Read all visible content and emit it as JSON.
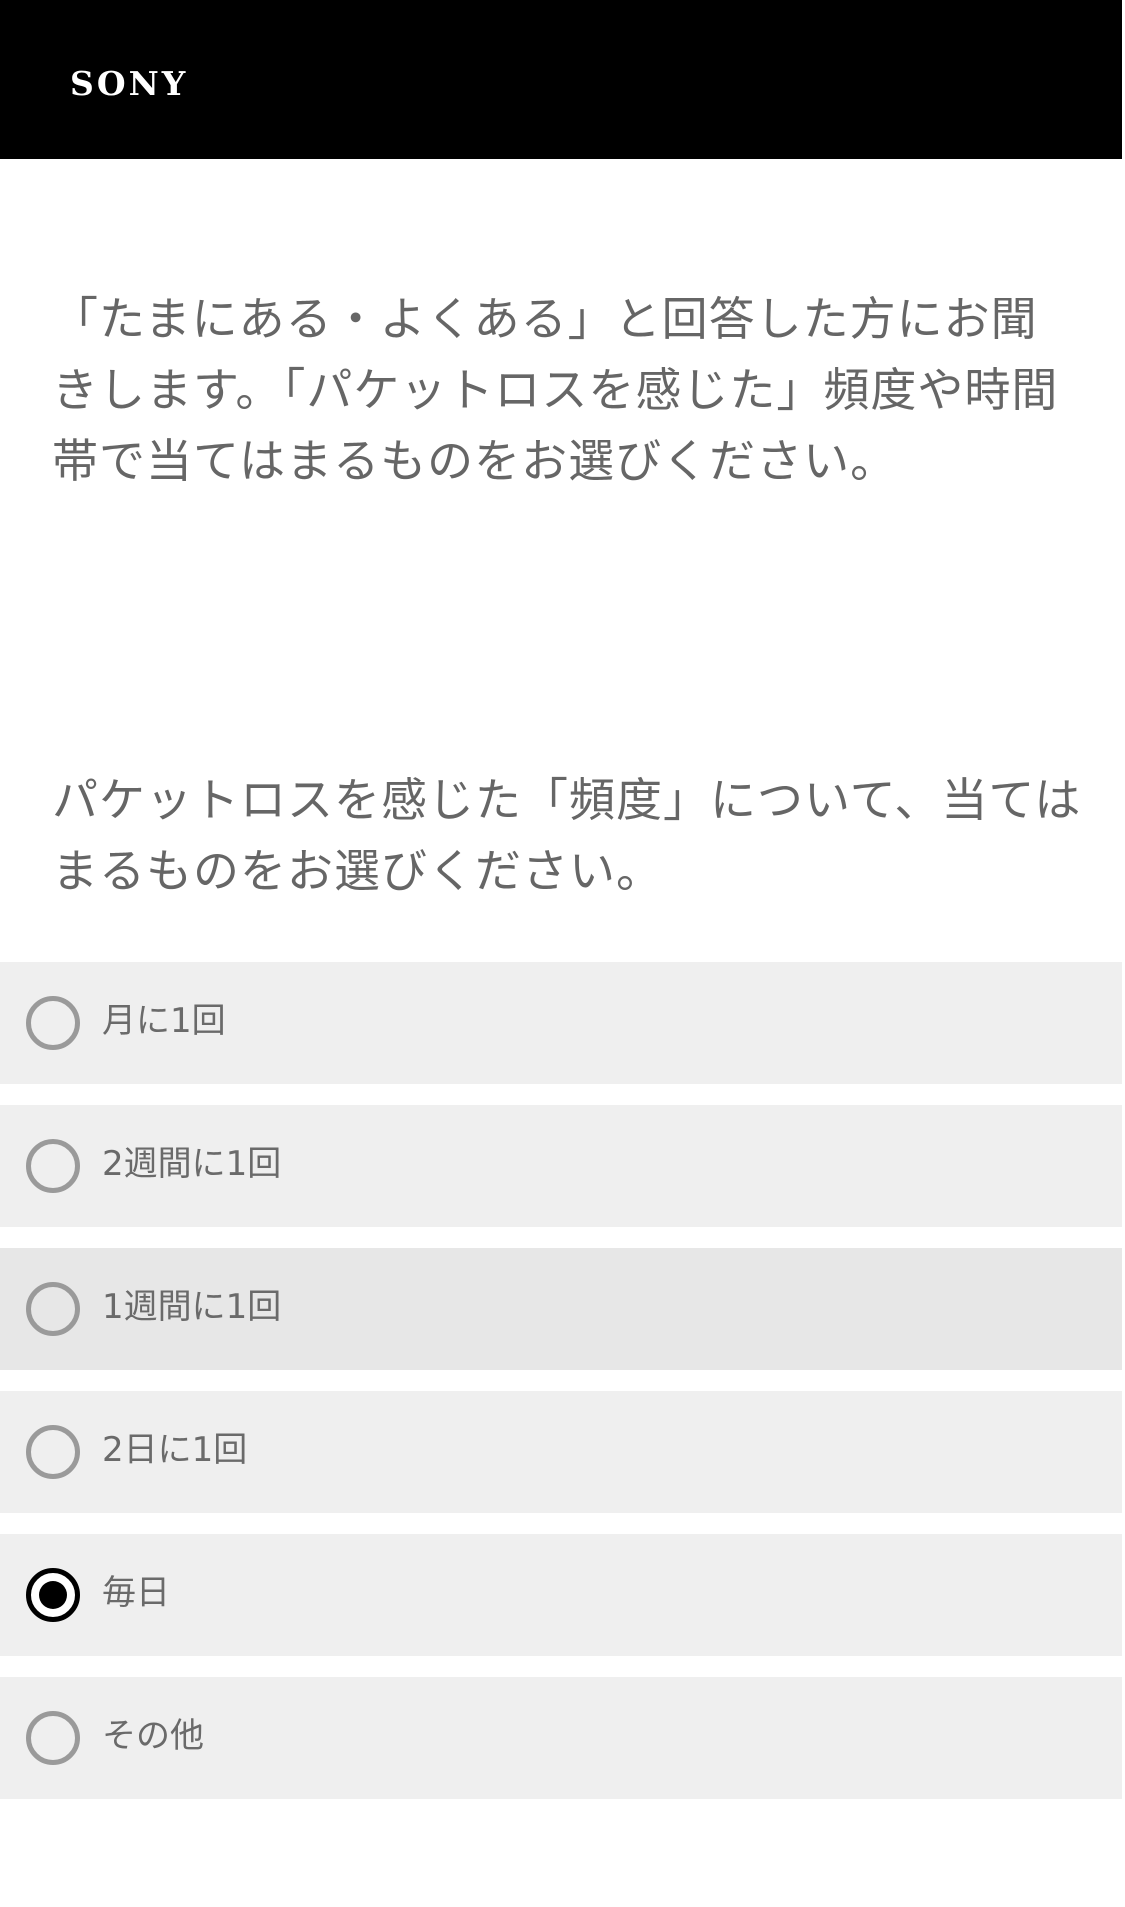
{
  "header": {
    "logo_text": "SONY"
  },
  "intro": {
    "text": "「たまにある・よくある」と回答した方にお聞きします。「パケットロスを感じた」頻度や時間帯で当てはまるものをお選びください。"
  },
  "question": {
    "text": "パケットロスを感じた「頻度」について、当てはまるものをお選びください。",
    "options": [
      {
        "label": "月に1回",
        "selected": false
      },
      {
        "label": "2週間に1回",
        "selected": false
      },
      {
        "label": "1週間に1回",
        "selected": false
      },
      {
        "label": "2日に1回",
        "selected": false
      },
      {
        "label": "毎日",
        "selected": true
      },
      {
        "label": "その他",
        "selected": false
      }
    ]
  },
  "colors": {
    "header_bg": "#000000",
    "option_bg": "#efefef",
    "text": "#666666",
    "radio_border": "#9a9a9a",
    "radio_selected": "#000000"
  }
}
